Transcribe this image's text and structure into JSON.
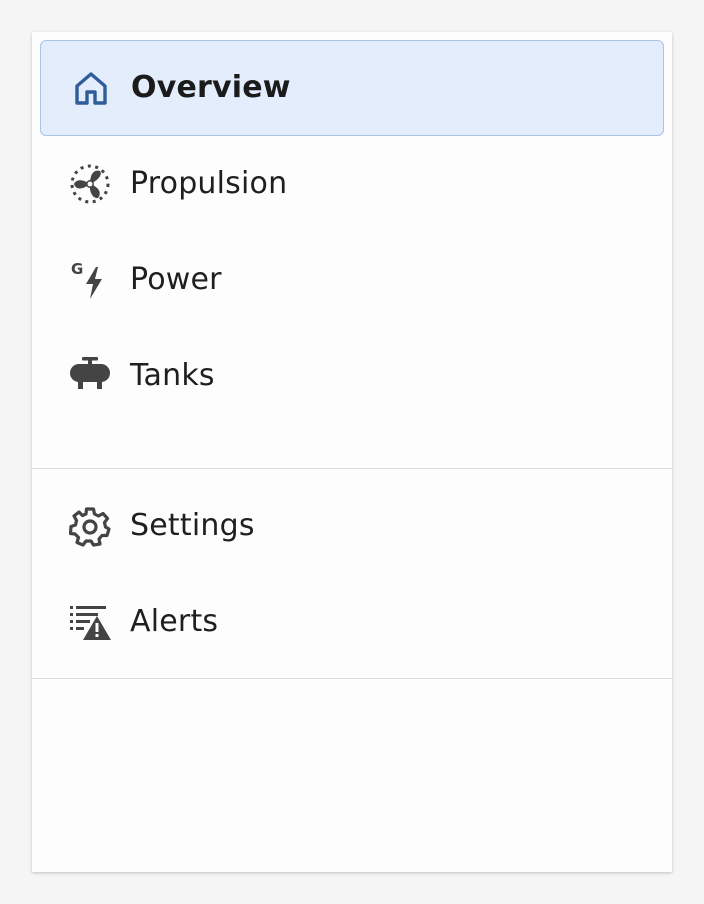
{
  "nav": {
    "primary": [
      {
        "id": "overview",
        "label": "Overview",
        "icon": "home-icon",
        "active": true
      },
      {
        "id": "propulsion",
        "label": "Propulsion",
        "icon": "fan-icon",
        "active": false
      },
      {
        "id": "power",
        "label": "Power",
        "icon": "generator-bolt-icon",
        "active": false
      },
      {
        "id": "tanks",
        "label": "Tanks",
        "icon": "tank-icon",
        "active": false
      }
    ],
    "secondary": [
      {
        "id": "settings",
        "label": "Settings",
        "icon": "gear-icon",
        "active": false
      },
      {
        "id": "alerts",
        "label": "Alerts",
        "icon": "alert-list-icon",
        "active": false
      }
    ]
  },
  "colors": {
    "active_background": "#e3edfb",
    "active_border": "#a9c6ea",
    "active_icon": "#2e5d99",
    "icon": "#444444",
    "text": "#1f1f1f",
    "divider": "#dcdcdc"
  }
}
